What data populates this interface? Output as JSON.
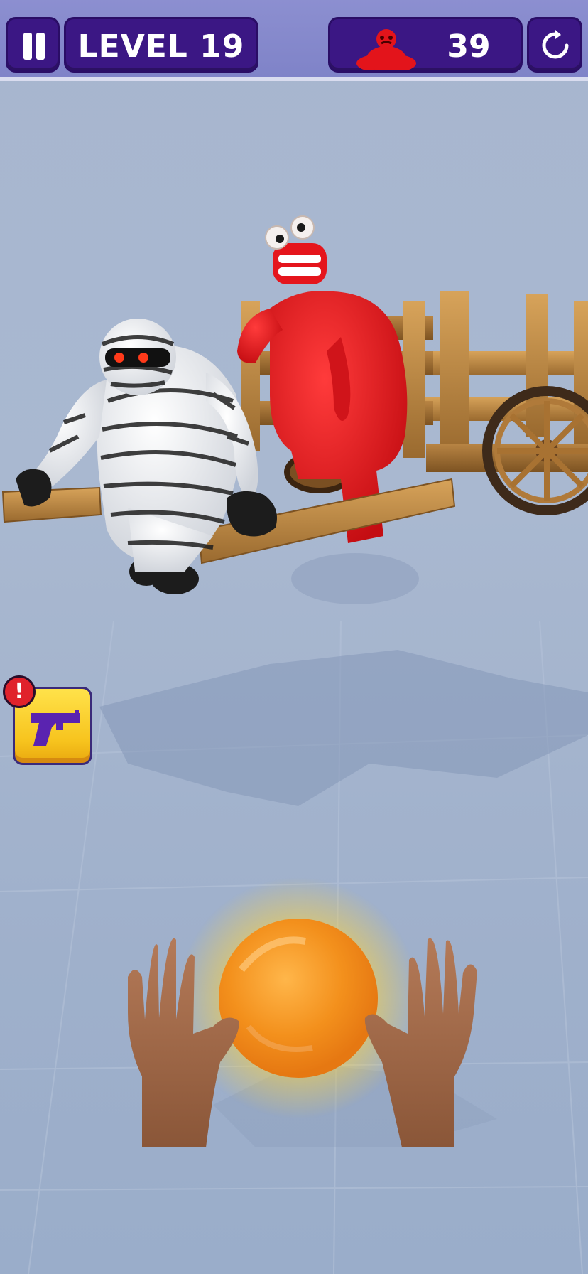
{
  "hud": {
    "level_label": "LEVEL 19",
    "kill_count": "39",
    "icons": {
      "pause": "pause-icon",
      "enemy": "red-monster-icon",
      "restart": "restart-icon"
    }
  },
  "weapon_button": {
    "icon": "pistol-icon",
    "alert_badge": "!"
  },
  "scene": {
    "characters": [
      "mummy",
      "red-monster"
    ],
    "props": [
      "wooden-cart",
      "energy-orb",
      "player-hands"
    ]
  },
  "colors": {
    "hud_background": "#8c8fd0",
    "hud_button": "#3b1784",
    "enemy_red": "#e3141b",
    "orb_orange": "#f39a1f",
    "weapon_yellow": "#f7c41e"
  }
}
